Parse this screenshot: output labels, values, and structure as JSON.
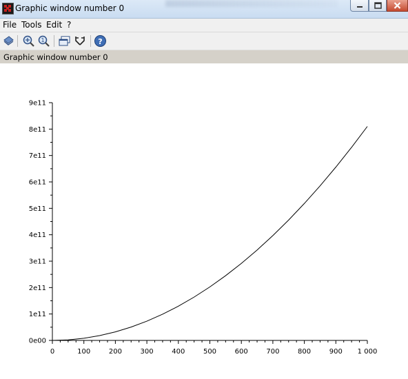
{
  "window": {
    "title": "Graphic window number 0",
    "buttons": {
      "minimize": "minimize-icon",
      "maximize": "maximize-icon",
      "close": "close-icon"
    }
  },
  "menu": {
    "items": [
      {
        "label": "File"
      },
      {
        "label": "Tools"
      },
      {
        "label": "Edit"
      },
      {
        "label": "?"
      }
    ]
  },
  "toolbar": {
    "tools": [
      "rotate-icon",
      "zoom-in-icon",
      "zoom-reset-icon",
      "window-icon",
      "datatip-icon",
      "help-icon"
    ]
  },
  "infobar": {
    "text": "Graphic window number 0"
  },
  "colors": {
    "titlebar": "#c9dcf1",
    "infobar": "#d5d1c9",
    "curve": "#000000"
  },
  "chart_data": {
    "type": "line",
    "title": "",
    "xlabel": "",
    "ylabel": "",
    "xlim": [
      0,
      1000
    ],
    "ylim": [
      0,
      900000000000
    ],
    "grid": false,
    "x_tick_labels": [
      "0",
      "100",
      "200",
      "300",
      "400",
      "500",
      "600",
      "700",
      "800",
      "900",
      "1 000"
    ],
    "y_tick_labels": [
      "0e00",
      "1e11",
      "2e11",
      "3e11",
      "4e11",
      "5e11",
      "6e11",
      "7e11",
      "8e11",
      "9e11"
    ],
    "series": [
      {
        "x": [
          0,
          50,
          100,
          150,
          200,
          250,
          300,
          350,
          400,
          450,
          500,
          550,
          600,
          650,
          700,
          750,
          800,
          850,
          900,
          950,
          1000
        ],
        "y": [
          0,
          2000000000,
          8100000000,
          18200000000,
          32400000000,
          50600000000,
          72900000000,
          99200000000,
          129600000000,
          164000000000,
          202500000000,
          245000000000,
          291600000000,
          342200000000,
          396900000000,
          455600000000,
          518400000000,
          585200000000,
          656100000000,
          731000000000,
          810000000000
        ]
      }
    ]
  }
}
